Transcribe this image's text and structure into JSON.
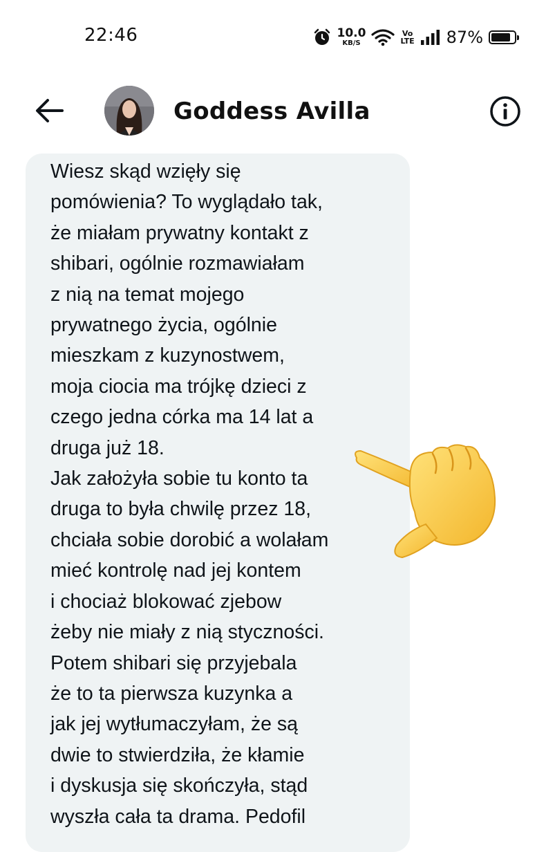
{
  "status_bar": {
    "time": "22:46",
    "net_speed_value": "10.0",
    "net_speed_unit": "KB/S",
    "volte_top": "Vo",
    "volte_bottom": "LTE",
    "battery_percent": "87%",
    "battery_level": 0.87
  },
  "header": {
    "contact_name": "Goddess Avilla",
    "icons": [
      "back-arrow-icon",
      "info-icon"
    ]
  },
  "message": {
    "text": "Wiesz skąd wzięły się\npomówienia? To wyglądało tak,\nże miałam prywatny kontakt z\nshibari, ogólnie rozmawiałam\nz nią na temat mojego\nprywatnego życia, ogólnie\nmieszkam z kuzynostwem,\nmoja ciocia ma trójkę dzieci z\nczego jedna córka ma 14 lat a\ndruga już 18.\nJak założyła sobie tu konto ta\ndruga to była chwilę przez 18,\nchciała sobie dorobić a wolałam\nmieć kontrolę nad jej kontem\ni chociaż blokować zjebow\nżeby nie miały z nią styczności.\nPotem shibari się przyjebala\nże to ta pierwsza kuzynka a\njak jej wytłumaczyłam, że są\ndwie to stwierdziła, że kłamie\ni dyskusja się skończyła, stąd\nwyszła cała ta drama. Pedofil",
    "bubble_color": "#eff3f4"
  },
  "overlay": {
    "emoji": "backhand-index-pointing-left",
    "emoji_color": "#f7c73a"
  }
}
